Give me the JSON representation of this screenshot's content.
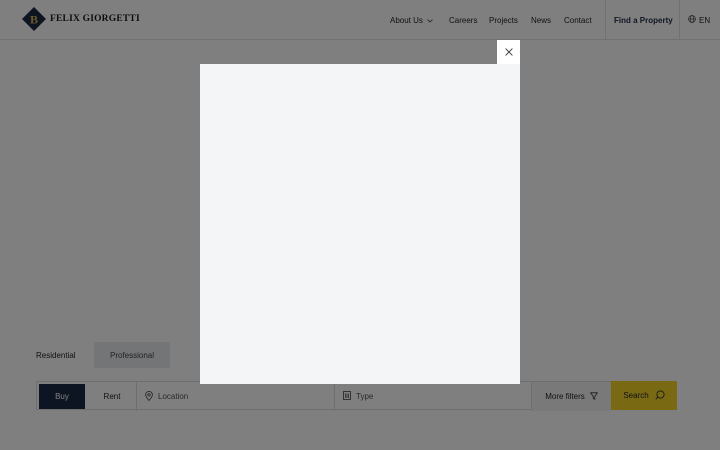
{
  "header": {
    "logo_text": "FELIX GIORGETTI",
    "nav": {
      "about": "About Us",
      "careers": "Careers",
      "projects": "Projects",
      "news": "News",
      "contact": "Contact",
      "find_property": "Find a Property",
      "language": "EN"
    }
  },
  "search": {
    "tabs": [
      "Residential",
      "Professional"
    ],
    "modes": [
      "Buy",
      "Rent"
    ],
    "location_placeholder": "Location",
    "type_placeholder": "Type",
    "more_filters": "More filters",
    "search_label": "Search"
  },
  "colors": {
    "navy": "#1c2b45",
    "accent_yellow": "#f2d326",
    "overlay": "rgba(0,0,0,0.5)"
  },
  "icons": {
    "logo": "fg-logo-icon",
    "chevron": "chevron-down-icon",
    "globe": "globe-icon",
    "pin": "location-pin-icon",
    "building": "building-icon",
    "filter": "filter-icon",
    "search": "search-icon",
    "close": "close-icon"
  }
}
